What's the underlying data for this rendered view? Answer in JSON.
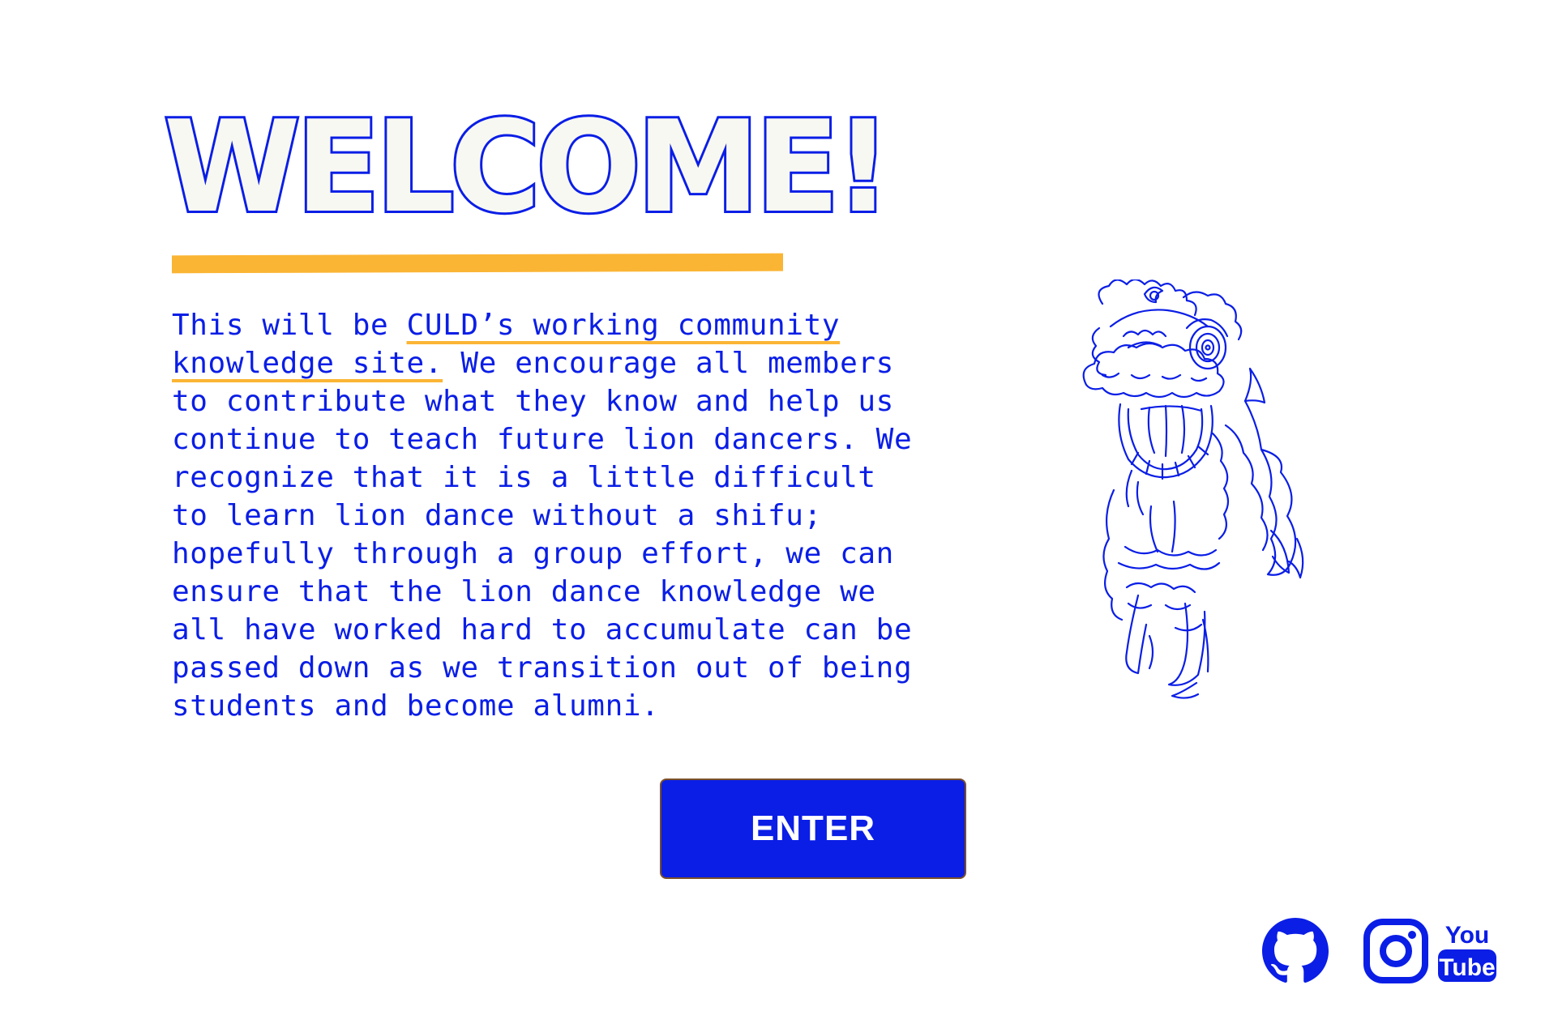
{
  "welcome": {
    "title": "WELCOME!"
  },
  "intro": {
    "prefix": "This will be ",
    "link_text": "CULD’s working community knowledge site.",
    "body": " We encourage all members to contribute what they know and help us continue to teach future lion dancers. We recognize that it is a little difficult to learn lion dance without a shifu; hopefully through a group effort, we can ensure that the lion dance knowledge we all have worked hard to accumulate can be passed down as we transition out of being students and become alumni."
  },
  "enter_button": {
    "label": "ENTER"
  },
  "social": {
    "github": "github-icon",
    "instagram": "instagram-icon",
    "youtube": "youtube-icon",
    "youtube_top": "You",
    "youtube_bottom": "Tube"
  },
  "colors": {
    "primary_blue": "#0a1ee6",
    "accent_yellow": "#fbb534",
    "title_fill": "#f8f8f2",
    "background": "#ffffff"
  }
}
